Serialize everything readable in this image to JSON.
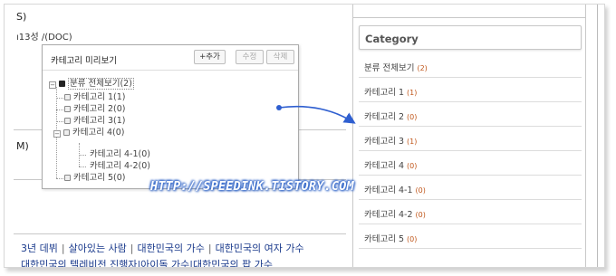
{
  "background": {
    "frag1": "S)",
    "frag2": "ı13성  /(DOC)",
    "frag3": "M)"
  },
  "sidebar": {
    "title": "Category",
    "items": [
      {
        "label": "분류 전체보기",
        "count": "(2)"
      },
      {
        "label": "카테고리 1",
        "count": "(1)"
      },
      {
        "label": "카테고리 2",
        "count": "(0)"
      },
      {
        "label": "카테고리 3",
        "count": "(1)"
      },
      {
        "label": "카테고리 4",
        "count": "(0)"
      },
      {
        "label": "카테고리 4-1",
        "count": "(0)"
      },
      {
        "label": "카테고리 4-2",
        "count": "(0)"
      },
      {
        "label": "카테고리 5",
        "count": "(0)"
      }
    ]
  },
  "popup": {
    "title": "카테고리 미리보기",
    "add_label": "+추가",
    "edit_label": "수정",
    "delete_label": "삭제",
    "tree": [
      "분류 전체보기(2)",
      "카테고리 1(1)",
      "카테고리 2(0)",
      "카테고리 3(1)",
      "카테고리 4(0)",
      "카테고리 4-1(0)",
      "카테고리 4-2(0)",
      "카테고리 5(0)"
    ]
  },
  "watermark": "HTTP://SPEEDINK.TISTORY.COM",
  "tags": {
    "row1": [
      "3년 데뷔",
      "살아있는 사람",
      "대한민국의 가수",
      "대한민국의 여자 가수"
    ],
    "row2": [
      "대한민국의 텔레비전 진행자",
      "아이돌 가수",
      "대한민국의 팝 가수"
    ]
  },
  "colors": {
    "count": "#c0561a",
    "link": "#1a3a8c",
    "arrow": "#2f5fd0"
  }
}
